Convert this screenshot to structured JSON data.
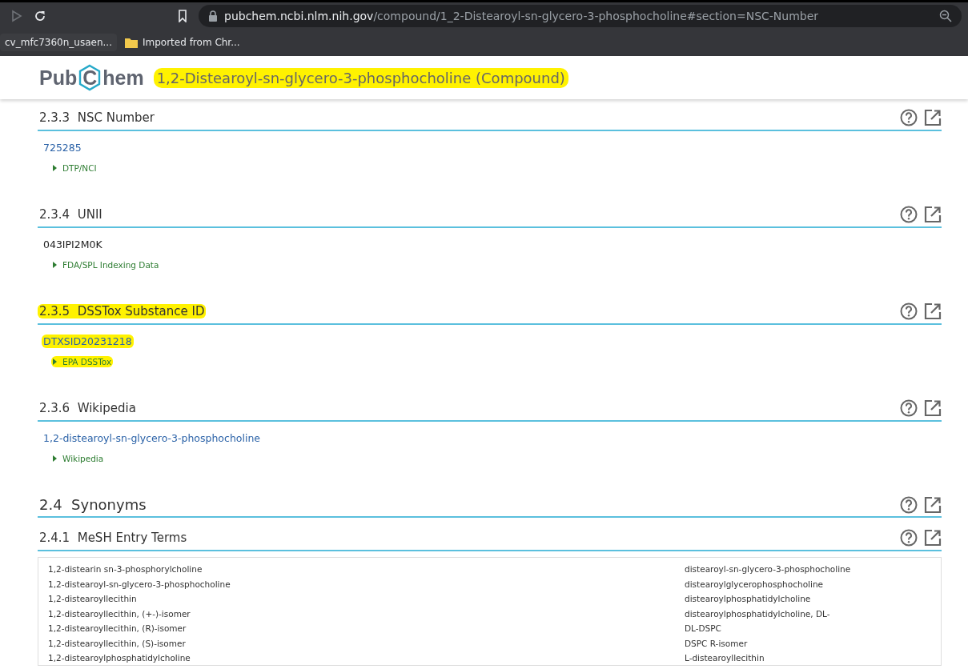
{
  "browser": {
    "url_host": "pubchem.ncbi.nlm.nih.gov",
    "url_path": "/compound/1_2-Distearoyl-sn-glycero-3-phosphocholine#section=NSC-Number",
    "bookmarks": [
      {
        "label": "cv_mfc7360n_usaen...",
        "kind": "page"
      },
      {
        "label": "Imported from Chr...",
        "kind": "folder"
      }
    ]
  },
  "header": {
    "logo": [
      "Pub",
      "C",
      "hem"
    ],
    "title": "1,2-Distearoyl-sn-glycero-3-phosphocholine (Compound)",
    "highlighted": true
  },
  "sections": [
    {
      "kind": "subsection",
      "number": "2.3.3",
      "heading": "NSC Number",
      "value": "725285",
      "is_link": true,
      "source": "DTP/NCI",
      "highlighted": false
    },
    {
      "kind": "subsection",
      "number": "2.3.4",
      "heading": "UNII",
      "value": "043IPI2M0K",
      "is_link": false,
      "source": "FDA/SPL Indexing Data",
      "highlighted": false
    },
    {
      "kind": "subsection",
      "number": "2.3.5",
      "heading": "DSSTox Substance ID",
      "value": "DTXSID20231218",
      "is_link": true,
      "source": "EPA DSSTox",
      "highlighted": true
    },
    {
      "kind": "subsection",
      "number": "2.3.6",
      "heading": "Wikipedia",
      "value": "1,2-distearoyl-sn-glycero-3-phosphocholine",
      "is_link": true,
      "source": "Wikipedia",
      "highlighted": false
    },
    {
      "kind": "section",
      "number": "2.4",
      "heading": "Synonyms"
    },
    {
      "kind": "list",
      "number": "2.4.1",
      "heading": "MeSH Entry Terms",
      "columns": [
        [
          "1,2-distearin sn-3-phosphorylcholine",
          "1,2-distearoyl-sn-glycero-3-phosphocholine",
          "1,2-distearoyllecithin",
          "1,2-distearoyllecithin, (+-)-isomer",
          "1,2-distearoyllecithin, (R)-isomer",
          "1,2-distearoyllecithin, (S)-isomer",
          "1,2-distearoylphosphatidylcholine"
        ],
        [
          "distearoyl-sn-glycero-3-phosphocholine",
          "distearoylglycerophosphocholine",
          "distearoylphosphatidylcholine",
          "distearoylphosphatidylcholine, DL-",
          "DL-DSPC",
          "DSPC R-isomer",
          "L-distearoyllecithin"
        ]
      ]
    }
  ]
}
